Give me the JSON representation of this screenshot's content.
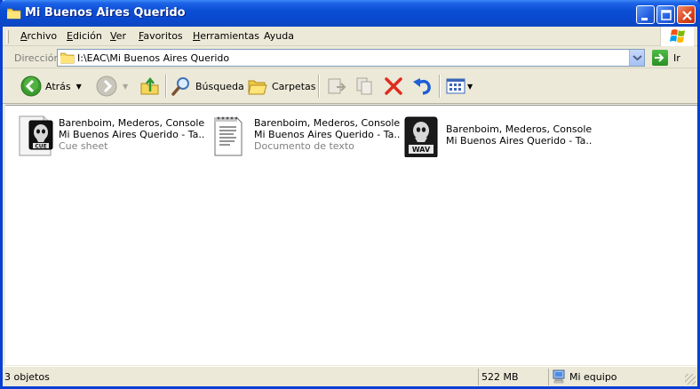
{
  "window": {
    "title": "Mi Buenos Aires Querido",
    "title_icon": "folder-icon",
    "controls": [
      "minimize-icon",
      "maximize-icon",
      "close-icon"
    ]
  },
  "menu": {
    "items": [
      {
        "accel": "A",
        "rest": "rchivo"
      },
      {
        "accel": "E",
        "rest": "dición"
      },
      {
        "accel": "V",
        "rest": "er"
      },
      {
        "accel": "F",
        "rest": "avoritos"
      },
      {
        "accel": "H",
        "rest": "erramientas"
      },
      {
        "accel": "",
        "rest": "Ayuda"
      }
    ]
  },
  "address": {
    "label": "Dirección",
    "path": "I:\\EAC\\Mi Buenos Aires Querido",
    "go_label": "Ir"
  },
  "toolbar": {
    "back_label": "Atrás",
    "search_label": "Búsqueda",
    "folders_label": "Carpetas",
    "icons": [
      "back-arrow-icon",
      "forward-arrow-icon",
      "up-folder-icon",
      "search-icon",
      "folders-icon",
      "move-to-icon",
      "copy-to-icon",
      "delete-icon",
      "undo-icon",
      "views-icon"
    ]
  },
  "files": [
    {
      "line1": "Barenboim, Mederos, Console -",
      "line2": "Mi Buenos Aires Querido - Ta...",
      "type": "Cue sheet",
      "icon": "cue-file-icon",
      "badge": "CUE"
    },
    {
      "line1": "Barenboim, Mederos, Console -",
      "line2": "Mi Buenos Aires Querido - Ta...",
      "type": "Documento de texto",
      "icon": "text-document-icon"
    },
    {
      "line1": "Barenboim, Mederos, Console -",
      "line2": "Mi Buenos Aires Querido - Ta...",
      "type": "",
      "icon": "wav-file-icon",
      "badge": "WAV"
    }
  ],
  "status": {
    "count": "3 objetos",
    "size": "522 MB",
    "location": "Mi equipo"
  },
  "colors": {
    "titlebar": "#0a4ed4",
    "close_button": "#d9441c",
    "content_bg": "#ffffff",
    "chrome": "#ece9d8"
  }
}
